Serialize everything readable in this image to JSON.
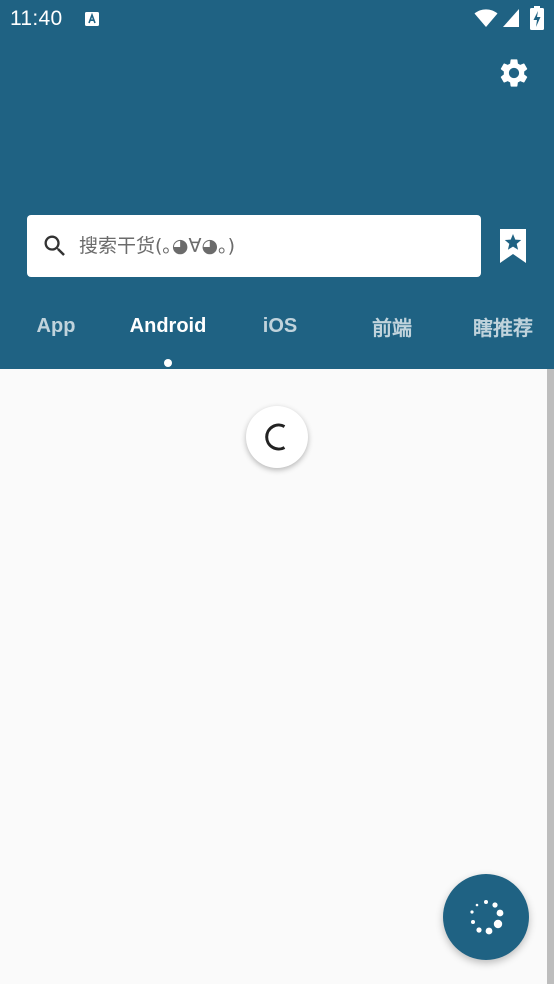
{
  "status_bar": {
    "time": "11:40",
    "icons": [
      "notification-a-icon",
      "wifi-icon",
      "cell-signal-icon",
      "battery-charging-icon"
    ]
  },
  "header": {
    "settings_icon": "gear-icon",
    "bookmark_icon": "bookmark-star-icon"
  },
  "search": {
    "placeholder": "搜索干货(｡◕∀◕｡)",
    "value": "",
    "icon": "search-icon"
  },
  "tabs": [
    {
      "label": "App",
      "active": false
    },
    {
      "label": "Android",
      "active": true
    },
    {
      "label": "iOS",
      "active": false
    },
    {
      "label": "前端",
      "active": false
    },
    {
      "label": "瞎推荐",
      "active": false
    }
  ],
  "content": {
    "loading_icon": "loading-spinner-icon"
  },
  "fab": {
    "icon": "loading-dots-icon"
  },
  "colors": {
    "primary": "#1F6283",
    "background": "#FAFAFA",
    "surface": "#FFFFFF"
  }
}
